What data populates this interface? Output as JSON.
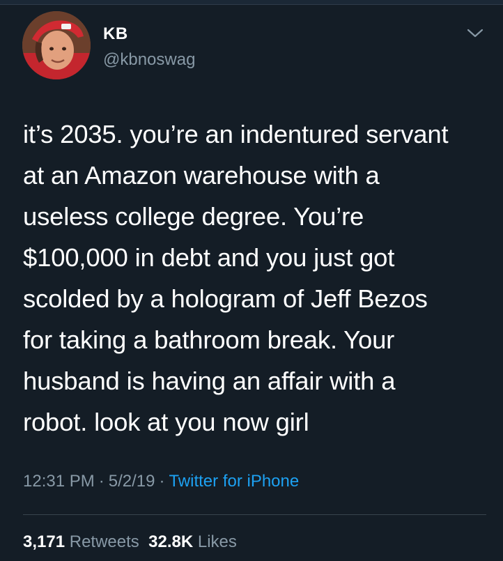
{
  "author": {
    "display_name": "KB",
    "handle": "@kbnoswag",
    "avatar_icon": "profile-photo"
  },
  "menu": {
    "icon": "chevron-down-icon"
  },
  "tweet": {
    "text": "it’s 2035. you’re an indentured servant\nat an Amazon warehouse with a\nuseless college degree. You’re\n$100,000 in debt and you just got\nscolded by a hologram of Jeff Bezos\nfor taking a bathroom break. Your\nhusband is having an affair with a\nrobot. look at you now girl",
    "time": "12:31 PM",
    "date": "5/2/19",
    "separator": "·",
    "source": "Twitter for iPhone"
  },
  "stats": {
    "retweets_count": "3,171",
    "retweets_label": "Retweets",
    "likes_count": "32.8K",
    "likes_label": "Likes"
  },
  "colors": {
    "background": "#141d26",
    "secondary_text": "#8899a6",
    "link": "#1da1f2",
    "divider": "#38444d"
  }
}
